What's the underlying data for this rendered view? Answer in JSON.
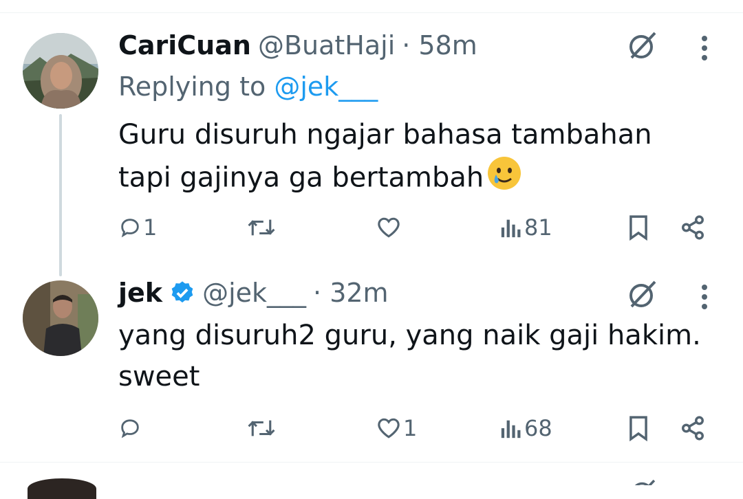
{
  "tweets": [
    {
      "name": "CariCuan",
      "handle": "@BuatHaji",
      "time": "· 58m",
      "replying_prefix": "Replying to ",
      "replying_handle": "@jek___",
      "text_line1": "Guru disuruh ngajar bahasa tambahan",
      "text_line2": "tapi gajinya ga bertambah",
      "emoji": "smiling-face-with-tear",
      "replies": "1",
      "retweets": "",
      "likes": "",
      "views": "81",
      "verified": false
    },
    {
      "name": "jek",
      "handle": "@jek___",
      "time": "· 32m",
      "text_line1": "yang disuruh2 guru, yang naik gaji hakim.",
      "text_line2": "sweet",
      "replies": "",
      "retweets": "",
      "likes": "1",
      "views": "68",
      "verified": true
    }
  ],
  "colors": {
    "text": "#0f1419",
    "secondary": "#536471",
    "link": "#1d9bf0",
    "verified": "#1d9bf0",
    "thread_line": "#cfd9de"
  }
}
